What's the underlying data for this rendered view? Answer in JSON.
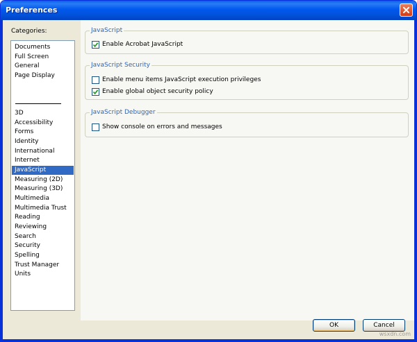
{
  "window": {
    "title": "Preferences",
    "title_color": "#ffffff",
    "titlebar_color": "#0058ee"
  },
  "sidebar": {
    "label": "Categories:",
    "selected_color": "#316ac5",
    "group1": [
      "Documents",
      "Full Screen",
      "General",
      "Page Display"
    ],
    "group2": [
      "3D",
      "Accessibility",
      "Forms",
      "Identity",
      "International",
      "Internet",
      "JavaScript",
      "Measuring (2D)",
      "Measuring (3D)",
      "Multimedia",
      "Multimedia Trust",
      "Reading",
      "Reviewing",
      "Search",
      "Security",
      "Spelling",
      "Trust Manager",
      "Units"
    ],
    "selected": "JavaScript"
  },
  "groups": {
    "javascript": {
      "title": "JavaScript",
      "enable_js": {
        "label": "Enable Acrobat JavaScript",
        "checked": true
      }
    },
    "security": {
      "title": "JavaScript Security",
      "menu_items": {
        "label": "Enable menu items JavaScript execution privileges",
        "checked": false
      },
      "global_policy": {
        "label": "Enable global object security policy",
        "checked": true
      }
    },
    "debugger": {
      "title": "JavaScript Debugger",
      "show_console": {
        "label": "Show console on errors and messages",
        "checked": false
      }
    }
  },
  "buttons": {
    "ok": "OK",
    "cancel": "Cancel"
  },
  "watermark": "wsxdn.com",
  "group_title_color": "#2c64b9"
}
